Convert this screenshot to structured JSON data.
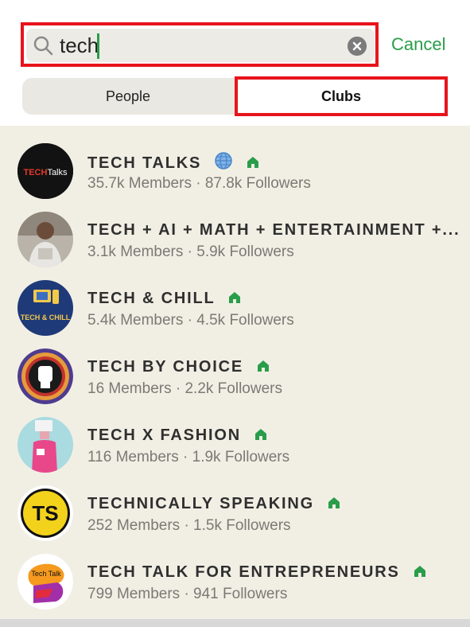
{
  "search": {
    "value": "tech",
    "cancel_label": "Cancel"
  },
  "tabs": {
    "people_label": "People",
    "clubs_label": "Clubs",
    "active": "Clubs"
  },
  "colors": {
    "accent": "#2a9d4a",
    "highlight": "#e8141b",
    "list_background": "#f1efe4"
  },
  "clubs": [
    {
      "name": "TECH TALKS",
      "stats": "35.7k Members · 87.8k Followers",
      "globe": true,
      "avatar_label": "TECHTalks"
    },
    {
      "name": "TECH + AI + MATH + ENTERTAINMENT +...",
      "stats": "3.1k Members · 5.9k Followers",
      "avatar_label": ""
    },
    {
      "name": "TECH & CHILL",
      "stats": "5.4k Members · 4.5k Followers",
      "avatar_label": "TECH & CHILL"
    },
    {
      "name": "TECH BY CHOICE",
      "stats": "16 Members · 2.2k Followers",
      "avatar_label": ""
    },
    {
      "name": "TECH X FASHION",
      "stats": "116 Members · 1.9k Followers",
      "avatar_label": ""
    },
    {
      "name": "TECHNICALLY SPEAKING",
      "stats": "252 Members · 1.5k Followers",
      "avatar_label": "TS"
    },
    {
      "name": "TECH TALK FOR ENTREPRENEURS",
      "stats": "799 Members · 941 Followers",
      "avatar_label": "Tech Talk"
    }
  ]
}
